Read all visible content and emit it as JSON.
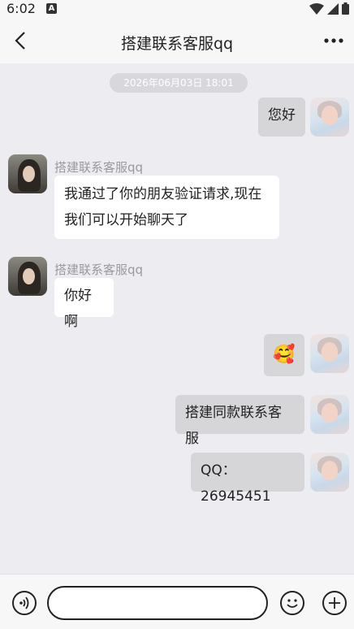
{
  "status_bar": {
    "time": "6:02",
    "notification_icon": "a-icon",
    "icons": [
      "wifi-icon",
      "signal-icon",
      "battery-icon"
    ]
  },
  "header": {
    "title": "搭建联系客服qq",
    "back_icon": "chevron-left-icon",
    "more_icon": "more-dots-icon"
  },
  "chat": {
    "timestamp": "2026年06月03日 18:01",
    "messages": [
      {
        "from": "me",
        "text": "您好"
      },
      {
        "from": "them",
        "sender": "搭建联系客服qq",
        "text_line1": "我通过了你的朋友验证请求,现在",
        "text_line2": "我们可以开始聊天了"
      },
      {
        "from": "them",
        "sender": "搭建联系客服qq",
        "text": "你好啊"
      },
      {
        "from": "me",
        "emoji": "🥰"
      },
      {
        "from": "me",
        "text": "搭建同款联系客服"
      },
      {
        "from": "me",
        "text": "QQ：26945451"
      }
    ]
  },
  "input_bar": {
    "voice_icon": "voice-icon",
    "input_value": "",
    "emoji_icon": "emoji-icon",
    "add_icon": "plus-icon"
  },
  "colors": {
    "background": "#edecf1",
    "bubble_me": "#d6d6d8",
    "bubble_them": "#ffffff",
    "bar": "#f7f7f7"
  }
}
